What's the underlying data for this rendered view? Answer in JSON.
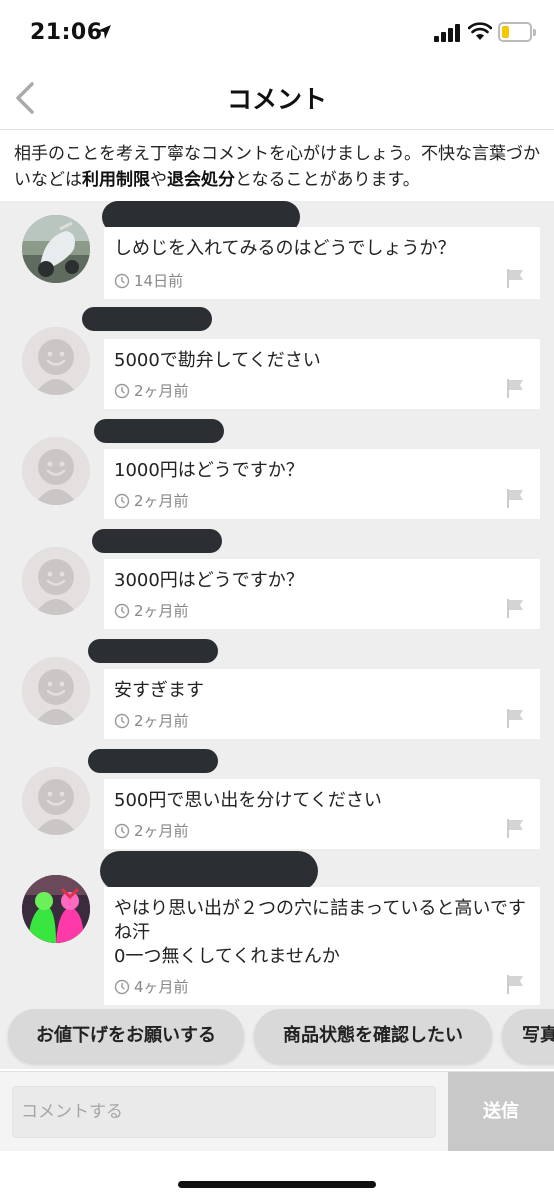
{
  "status_bar": {
    "time": "21:06",
    "battery_level": 0.25,
    "battery_color": "#f5c800"
  },
  "nav": {
    "title": "コメント"
  },
  "notice": {
    "part1": "相手のことを考え丁寧なコメントを心がけましょう。不快な言葉づかいなどは",
    "strong1": "利用制限",
    "part2": "や",
    "strong2": "退会処分",
    "part3": "となることがあります。"
  },
  "comments": [
    {
      "text": "しめじを入れてみるのはどうでしょうか？",
      "time": "14日前",
      "avatar": "photo"
    },
    {
      "text": "5000で勘弁してください",
      "time": "2ヶ月前",
      "avatar": "default"
    },
    {
      "text": "1000円はどうですか？",
      "time": "2ヶ月前",
      "avatar": "default"
    },
    {
      "text": "3000円はどうですか？",
      "time": "2ヶ月前",
      "avatar": "default"
    },
    {
      "text": "安すぎます",
      "time": "2ヶ月前",
      "avatar": "default"
    },
    {
      "text": "500円で思い出を分けてください",
      "time": "2ヶ月前",
      "avatar": "default"
    },
    {
      "text": "やはり思い出が２つの穴に詰まっていると高いですね汗\n0一つ無くしてくれませんか",
      "time": "4ヶ月前",
      "avatar": "photo"
    }
  ],
  "chips": [
    "お値下げをお願いする",
    "商品状態を確認したい",
    "写真"
  ],
  "input": {
    "placeholder": "コメントする",
    "value": ""
  },
  "send_label": "送信"
}
